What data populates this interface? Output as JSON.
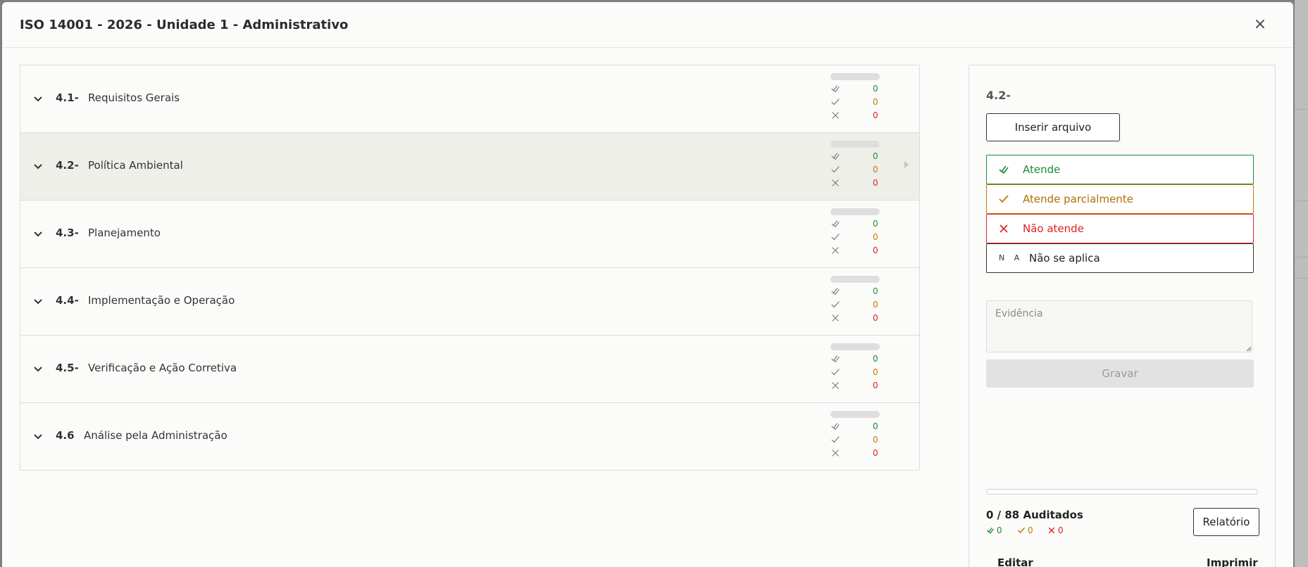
{
  "modal": {
    "title": "ISO 14001 - 2026 - Unidade 1 - Administrativo",
    "close_label": "×"
  },
  "sections": [
    {
      "code": "4.1-",
      "title": "Requisitos Gerais",
      "met": 0,
      "partial": 0,
      "not_met": 0,
      "progress": 0,
      "selected": false
    },
    {
      "code": "4.2-",
      "title": "Política Ambiental",
      "met": 0,
      "partial": 0,
      "not_met": 0,
      "progress": 0,
      "selected": true
    },
    {
      "code": "4.3-",
      "title": "Planejamento",
      "met": 0,
      "partial": 0,
      "not_met": 0,
      "progress": 0,
      "selected": false
    },
    {
      "code": "4.4-",
      "title": "Implementação e Operação",
      "met": 0,
      "partial": 0,
      "not_met": 0,
      "progress": 0,
      "selected": false
    },
    {
      "code": "4.5-",
      "title": "Verificação e Ação Corretiva",
      "met": 0,
      "partial": 0,
      "not_met": 0,
      "progress": 0,
      "selected": false
    },
    {
      "code": "4.6",
      "title": "Análise pela Administração",
      "met": 0,
      "partial": 0,
      "not_met": 0,
      "progress": 0,
      "selected": false
    }
  ],
  "panel": {
    "selected_code": "4.2-",
    "upload_label": "Inserir arquivo",
    "options": {
      "met": "Atende",
      "partial": "Atende parcialmente",
      "not_met": "Não atende",
      "na_icon": "N A",
      "na": "Não se aplica"
    },
    "evidence_placeholder": "Evidência",
    "save_label": "Gravar",
    "overall_progress": 0,
    "audited_text": "0 / 88 Auditados",
    "totals": {
      "met": "0",
      "partial": "0",
      "not_met": "0"
    },
    "report_label": "Relatório",
    "edit_label": "Editar",
    "print_label": "Imprimir"
  },
  "colors": {
    "met": "#1f8a3a",
    "partial": "#c27b00",
    "not_met": "#e02020",
    "selected_row": "#efefea"
  },
  "icons": {
    "expand": "chevron-down-icon",
    "met": "double-check-icon",
    "partial": "check-icon",
    "not_met": "x-icon",
    "close": "close-icon"
  }
}
